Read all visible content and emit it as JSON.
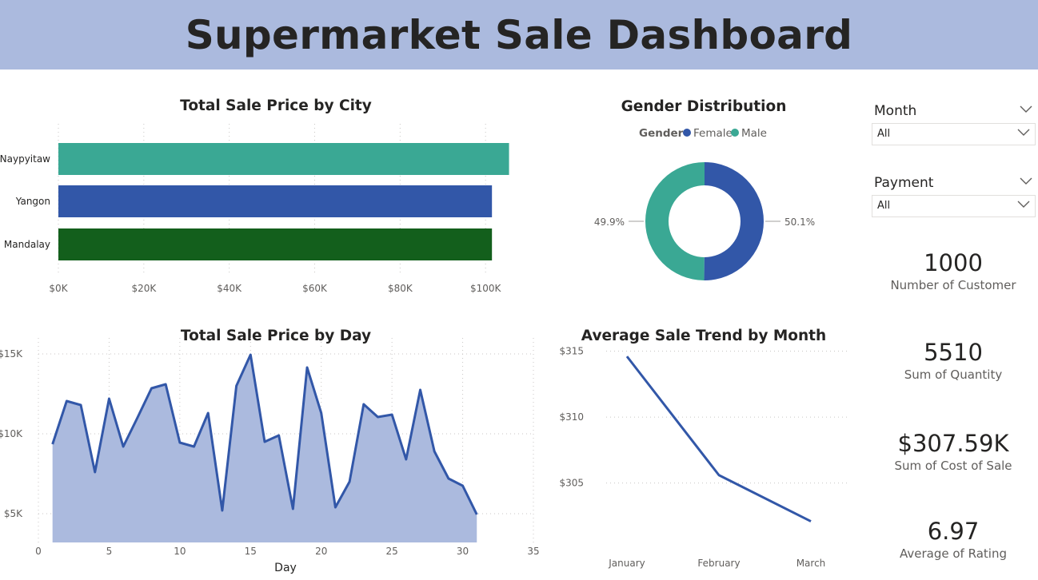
{
  "header": {
    "title": "Supermarket Sale Dashboard"
  },
  "city_chart": {
    "title": "Total Sale Price by City",
    "chart_data": {
      "type": "bar",
      "orientation": "horizontal",
      "title": "Total Sale Price by City",
      "categories": [
        "Naypyitaw",
        "Yangon",
        "Mandalay"
      ],
      "values": [
        105500,
        101500,
        101500
      ],
      "xlim": [
        0,
        120000
      ],
      "tick_labels": [
        "$0K",
        "$20K",
        "$40K",
        "$60K",
        "$80K",
        "$100K"
      ],
      "tick_values": [
        0,
        20000,
        40000,
        60000,
        80000,
        100000
      ],
      "colors": [
        "#3aa894",
        "#3257a8",
        "#135f1c"
      ],
      "grid": true
    }
  },
  "gender_chart": {
    "title": "Gender Distribution",
    "legend_title": "Gender",
    "chart_data": {
      "type": "pie",
      "donut": true,
      "title": "Gender Distribution",
      "legend_title": "Gender",
      "categories": [
        "Female",
        "Male"
      ],
      "values": [
        50.1,
        49.9
      ],
      "labels": [
        "50.1%",
        "49.9%"
      ],
      "colors": [
        "#3257a8",
        "#3aa894"
      ],
      "legend_position": "top"
    }
  },
  "day_chart": {
    "title": "Total Sale Price by Day",
    "xlabel": "Day",
    "chart_data": {
      "type": "area",
      "title": "Total Sale Price by Day",
      "xlabel": "Day",
      "x": [
        1,
        2,
        3,
        4,
        5,
        6,
        7,
        8,
        9,
        10,
        11,
        12,
        13,
        14,
        15,
        16,
        17,
        18,
        19,
        20,
        21,
        22,
        23,
        24,
        25,
        26,
        27,
        28,
        29,
        30,
        31
      ],
      "values": [
        9350,
        12050,
        11800,
        7600,
        12200,
        9200,
        11000,
        12850,
        13100,
        9450,
        9200,
        11300,
        5200,
        13000,
        14950,
        9500,
        9900,
        5300,
        14150,
        11300,
        5400,
        7000,
        11850,
        11050,
        11200,
        8400,
        12750,
        8900,
        7200,
        6750,
        4950
      ],
      "xlim": [
        0,
        35
      ],
      "ylim": [
        3200,
        16000
      ],
      "x_tick_values": [
        0,
        5,
        10,
        15,
        20,
        25,
        30,
        35
      ],
      "x_tick_labels": [
        "0",
        "5",
        "10",
        "15",
        "20",
        "25",
        "30",
        "35"
      ],
      "y_tick_values": [
        5000,
        10000,
        15000
      ],
      "y_tick_labels": [
        "$5K",
        "$10K",
        "$15K"
      ],
      "line_color": "#3257a8",
      "fill_color": "#abbade",
      "grid": true
    }
  },
  "month_chart": {
    "title": "Average Sale Trend by Month",
    "chart_data": {
      "type": "line",
      "title": "Average Sale Trend by Month",
      "categories": [
        "January",
        "February",
        "March"
      ],
      "values": [
        314.6,
        305.6,
        302.1
      ],
      "ylim": [
        300.5,
        316
      ],
      "y_tick_values": [
        305,
        310,
        315
      ],
      "y_tick_labels": [
        "$305",
        "$310",
        "$315"
      ],
      "line_color": "#3257a8",
      "grid": true
    }
  },
  "slicers": [
    {
      "title": "Month",
      "value": "All"
    },
    {
      "title": "Payment",
      "value": "All"
    }
  ],
  "cards": [
    {
      "value": "1000",
      "label": "Number of Customer"
    },
    {
      "value": "5510",
      "label": "Sum of Quantity"
    },
    {
      "value": "$307.59K",
      "label": "Sum of Cost of Sale"
    },
    {
      "value": "6.97",
      "label": "Average of Rating"
    }
  ]
}
